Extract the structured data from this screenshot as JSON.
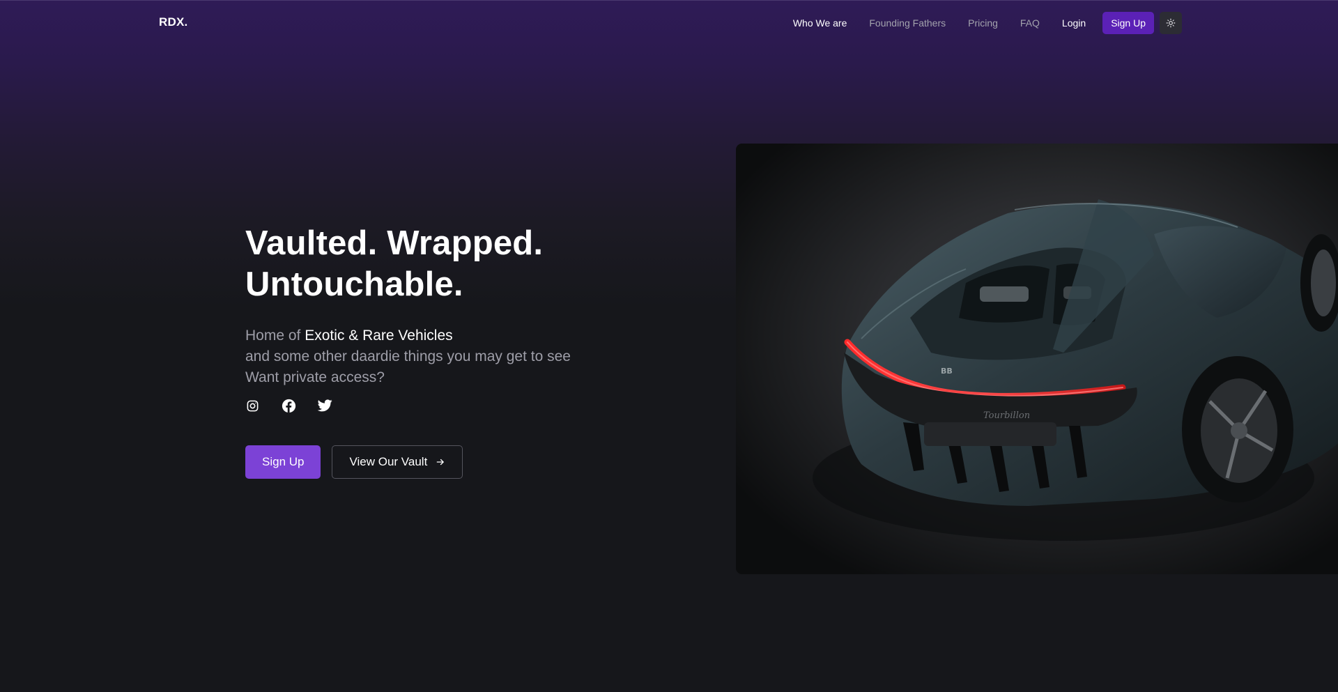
{
  "brand": {
    "logo": "RDX."
  },
  "nav": {
    "links": [
      {
        "label": "Who We are",
        "active": true
      },
      {
        "label": "Founding Fathers",
        "active": false
      },
      {
        "label": "Pricing",
        "active": false
      },
      {
        "label": "FAQ",
        "active": false
      }
    ],
    "login_label": "Login",
    "signup_label": "Sign Up",
    "theme_icon": "sun-icon"
  },
  "hero": {
    "title_line1": "Vaulted. Wrapped.",
    "title_line2": "Untouchable.",
    "sub_prefix": "Home of ",
    "sub_highlight": "Exotic & Rare Vehicles",
    "sub_line2": "and some other daardie things you may get to see",
    "sub_line3": "Want private access?",
    "socials": [
      "instagram-icon",
      "facebook-icon",
      "twitter-icon"
    ],
    "primary_cta": "Sign Up",
    "secondary_cta": "View Our Vault"
  },
  "colors": {
    "accent": "#7c42d6",
    "nav_signup_bg": "#5b21b6",
    "background": "#16171b",
    "header_glow": "#2f1b57"
  }
}
